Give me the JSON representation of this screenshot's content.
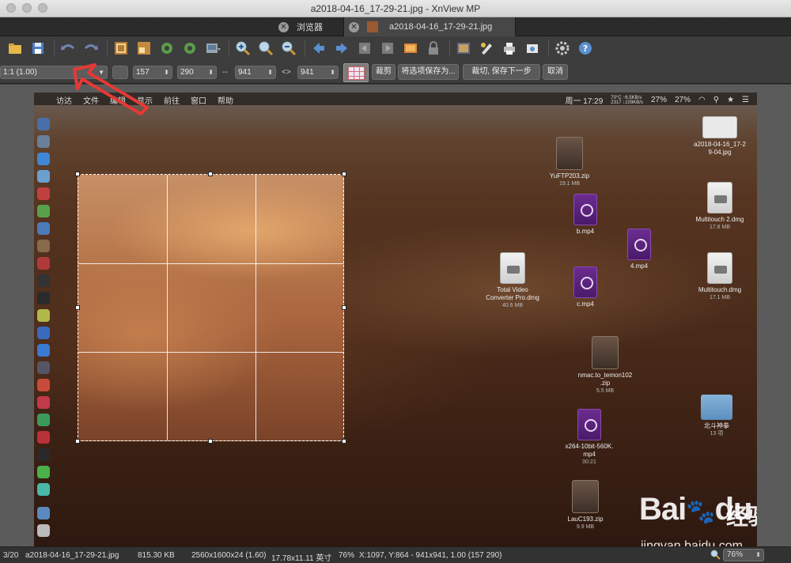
{
  "window": {
    "title": "a2018-04-16_17-29-21.jpg - XnView MP"
  },
  "tabs": [
    {
      "label": "浏览器"
    },
    {
      "label": "a2018-04-16_17-29-21.jpg"
    }
  ],
  "crop_toolbar": {
    "ratio_select": "1:1 (1.00)",
    "x_value": "157",
    "y_value": "290",
    "width_value": "941",
    "height_value": "941",
    "dash_label": "--",
    "swap_label": "<>",
    "crop_button": "裁剪",
    "save_selection_button": "将选项保存为...",
    "crop_save_next_button": "裁切, 保存下一步",
    "cancel_button": "取消"
  },
  "screenshot_content": {
    "menubar_left": [
      "访达",
      "文件",
      "编辑",
      "显示",
      "前往",
      "窗口",
      "帮助"
    ],
    "menubar_clock": "周一 17:29",
    "menubar_temp": "70°C ↑6.5KB/s",
    "menubar_net": "2317 ↓109KB/s",
    "menubar_battery1": "27%",
    "menubar_battery2": "27%",
    "files": [
      {
        "name": "a2018-04-16_17-2\n9-04.jpg",
        "size": "",
        "type": "jpg"
      },
      {
        "name": "YuFTP203.zip",
        "size": "19.1 MB",
        "type": "zip"
      },
      {
        "name": "Multitouch 2.dmg",
        "size": "17.8 MB",
        "type": "dmg"
      },
      {
        "name": "b.mp4",
        "size": "",
        "type": "mp4"
      },
      {
        "name": "4.mp4",
        "size": "",
        "type": "mp4"
      },
      {
        "name": "Total Video\nConverter Pro.dmg",
        "size": "40.6 MB",
        "type": "dmg"
      },
      {
        "name": "c.mp4",
        "size": "",
        "type": "mp4"
      },
      {
        "name": "Multitouch.dmg",
        "size": "17.1 MB",
        "type": "dmg"
      },
      {
        "name": "nmac.to_temon102\n.zip",
        "size": "5.5 MB",
        "type": "zip"
      },
      {
        "name": "北斗神拳",
        "size": "13 项",
        "type": "folder"
      },
      {
        "name": "x264-10bit-560K.\nmp4",
        "size": "00:21",
        "type": "mp4"
      },
      {
        "name": "LauC193.zip",
        "size": "9.9 MB",
        "type": "zip"
      }
    ],
    "watermark_word": "Bai",
    "watermark_word2": "du",
    "watermark_cn": "经验",
    "watermark_url": "jingyan.baidu.com"
  },
  "status_bar": {
    "index": "3/20",
    "filename": "a2018-04-16_17-29-21.jpg",
    "filesize": "815.30 KB",
    "dimensions": "2560x1600x24 (1.60)",
    "print_size": "17.78x11.11 英寸",
    "zoom_percent": "76%",
    "cursor_info": "X:1097, Y:864 - 941x941, 1.00 (157 290)",
    "zoom_select": "76%"
  },
  "colors": {
    "accent_arrow": "#e53935",
    "crop_border": "#ffffff"
  },
  "icons": [
    "folder-browse-icon",
    "save-icon",
    "undo-icon",
    "redo-icon",
    "crop-icon",
    "resize-icon",
    "rotate-left-icon",
    "rotate-right-icon",
    "adjust-icon",
    "zoom-in-icon",
    "zoom-fit-icon",
    "zoom-out-icon",
    "prev-icon",
    "next-icon",
    "first-icon",
    "last-icon",
    "slideshow-icon",
    "lock-icon",
    "fullscreen-icon",
    "edit-icon",
    "print-icon",
    "scan-icon",
    "settings-icon",
    "help-icon"
  ]
}
